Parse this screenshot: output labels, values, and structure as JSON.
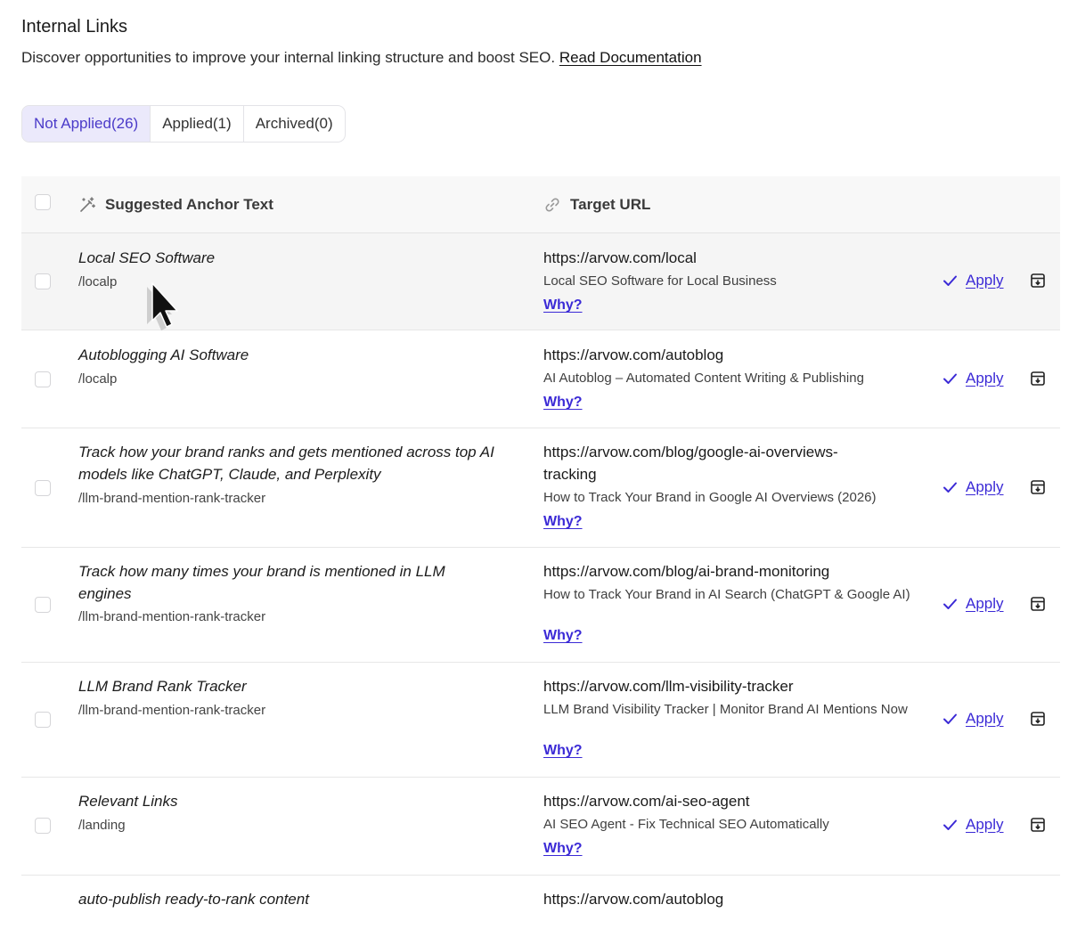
{
  "header": {
    "title": "Internal Links",
    "description": "Discover opportunities to improve your internal linking structure and boost SEO.",
    "doc_link": "Read Documentation"
  },
  "tabs": [
    {
      "label": "Not Applied(26)",
      "active": true
    },
    {
      "label": "Applied(1)",
      "active": false
    },
    {
      "label": "Archived(0)",
      "active": false
    }
  ],
  "table": {
    "col_anchor": "Suggested Anchor Text",
    "col_target": "Target URL",
    "why_label": "Why?",
    "apply_label": "Apply",
    "rows": [
      {
        "anchor": "Local SEO Software",
        "path": "/localp",
        "url": "https://arvow.com/local",
        "title": "Local SEO Software for Local Business"
      },
      {
        "anchor": "Autoblogging AI Software",
        "path": "/localp",
        "url": "https://arvow.com/autoblog",
        "title": "AI Autoblog – Automated Content Writing & Publishing"
      },
      {
        "anchor": "Track how your brand ranks and gets mentioned across top AI models like ChatGPT, Claude, and Perplexity",
        "path": "/llm-brand-mention-rank-tracker",
        "url": "https://arvow.com/blog/google-ai-overviews-tracking",
        "title": "How to Track Your Brand in Google AI Overviews (2026)"
      },
      {
        "anchor": "Track how many times your brand is mentioned in LLM engines",
        "path": "/llm-brand-mention-rank-tracker",
        "url": "https://arvow.com/blog/ai-brand-monitoring",
        "title": "How to Track Your Brand in AI Search (ChatGPT & Google AI)"
      },
      {
        "anchor": "LLM Brand Rank Tracker",
        "path": "/llm-brand-mention-rank-tracker",
        "url": "https://arvow.com/llm-visibility-tracker",
        "title": "LLM Brand Visibility Tracker | Monitor Brand AI Mentions Now"
      },
      {
        "anchor": "Relevant Links",
        "path": "/landing",
        "url": "https://arvow.com/ai-seo-agent",
        "title": "AI SEO Agent - Fix Technical SEO Automatically"
      },
      {
        "anchor": "auto-publish ready-to-rank content",
        "path": "",
        "url": "https://arvow.com/autoblog",
        "title": ""
      }
    ]
  },
  "colors": {
    "accent": "#3b2ad6",
    "tab_active_bg": "#ebe9fb"
  },
  "icons": [
    "magic-wand-icon",
    "link-icon",
    "check-icon",
    "archive-icon",
    "mouse-cursor-icon"
  ]
}
